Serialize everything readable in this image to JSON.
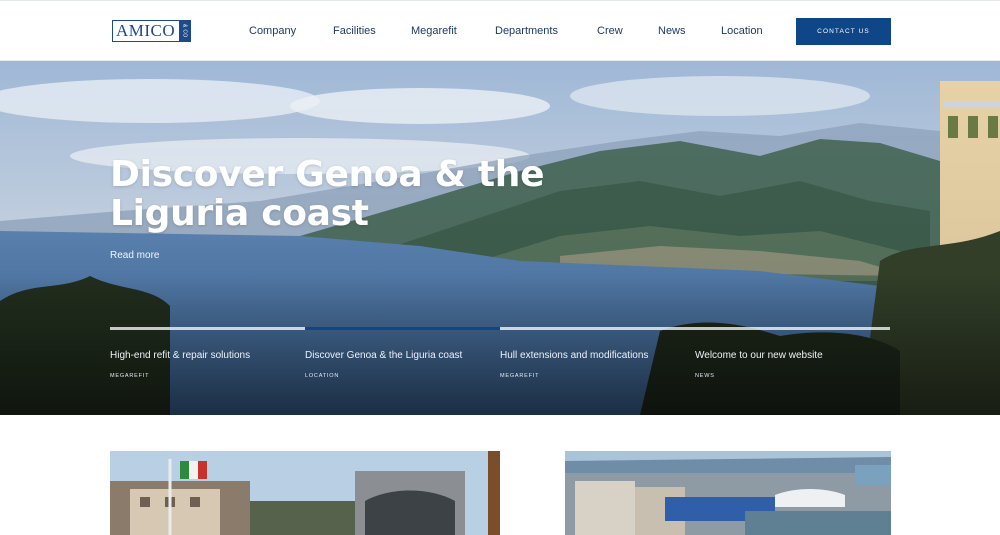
{
  "brand": {
    "name": "AMICO",
    "badge": "& CO"
  },
  "nav": {
    "items": [
      {
        "label": "Company"
      },
      {
        "label": "Facilities"
      },
      {
        "label": "Megarefit"
      },
      {
        "label": "Departments"
      },
      {
        "label": "Crew"
      },
      {
        "label": "News"
      },
      {
        "label": "Location"
      }
    ],
    "contact_label": "CONTACT US"
  },
  "hero": {
    "title": "Discover Genoa & the Liguria coast",
    "read_more": "Read more",
    "slides": [
      {
        "label": "High-end refit & repair solutions",
        "category": "MEGAREFIT",
        "active": false
      },
      {
        "label": "Discover Genoa & the Liguria coast",
        "category": "LOCATION",
        "active": true
      },
      {
        "label": "Hull extensions and modifications",
        "category": "MEGAREFIT",
        "active": false
      },
      {
        "label": "Welcome to our new website",
        "category": "NEWS",
        "active": false
      }
    ]
  },
  "colors": {
    "brand_blue": "#0e4687",
    "nav_text": "#1c3a66"
  }
}
